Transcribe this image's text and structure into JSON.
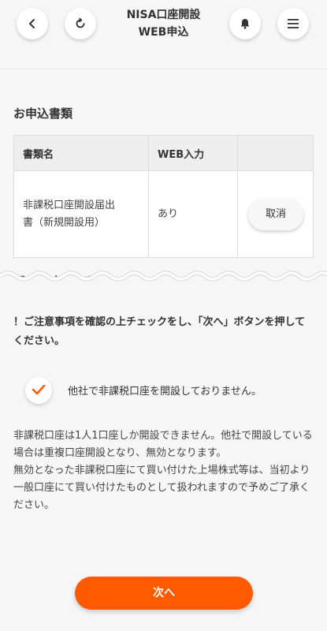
{
  "header": {
    "title_line1": "NISA口座開設",
    "title_line2": "WEB申込",
    "back_icon": "chevron-left-icon",
    "reload_icon": "reload-icon",
    "bell_icon": "bell-icon",
    "menu_icon": "menu-icon"
  },
  "section": {
    "title": "お申込書類",
    "table": {
      "headers": [
        "書類名",
        "WEB入力",
        ""
      ],
      "rows": [
        {
          "name_line1": "非課税口座開設届出",
          "name_line2": "書（新規開設用）",
          "web": "あり",
          "action": "取消"
        }
      ]
    }
  },
  "truncated_heading": "配慮の注出事項",
  "notice": "！ご注意事項を確認の上チェックをし、「次へ」ボタンを押してください。",
  "checkbox": {
    "checked": true,
    "label": "他社で非課税口座を開設しておりません。"
  },
  "description": {
    "para1": "非課税口座は1人1口座しか開設できません。他社で開設している場合は重複口座開設となり、無効となります。",
    "para2": "無効となった非課税口座にて買い付けた上場株式等は、当初より一般口座にて買い付けたものとして扱われますので予めご了承ください。"
  },
  "next_button": "次へ",
  "colors": {
    "accent": "#ff5a00",
    "background": "#f6f6f6"
  }
}
